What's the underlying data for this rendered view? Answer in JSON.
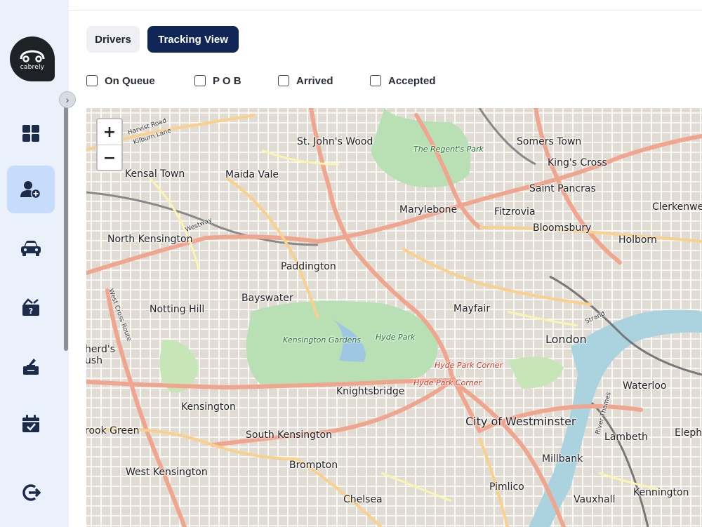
{
  "sidebar": {
    "logo_text": "cabrely",
    "items": [
      {
        "name": "dashboard",
        "active": false
      },
      {
        "name": "drivers",
        "active": true
      },
      {
        "name": "vehicles",
        "active": false
      },
      {
        "name": "lost-found",
        "active": false
      },
      {
        "name": "bookings",
        "active": false
      },
      {
        "name": "schedule",
        "active": false
      },
      {
        "name": "logout",
        "active": false
      }
    ]
  },
  "tabs": {
    "drivers": "Drivers",
    "tracking_view": "Tracking View"
  },
  "filters": [
    {
      "label": "On Queue",
      "checked": false
    },
    {
      "label": "P O B",
      "checked": false
    },
    {
      "label": "Arrived",
      "checked": false
    },
    {
      "label": "Accepted",
      "checked": false
    }
  ],
  "map": {
    "zoom_in": "+",
    "zoom_out": "−",
    "labels": {
      "st_johns_wood": "St. John's Wood",
      "somers_town": "Somers Town",
      "kings_cross": "King's Cross",
      "kensal_town": "Kensal Town",
      "maida_vale": "Maida Vale",
      "regents_park": "The Regent's Park",
      "saint_pancras": "Saint Pancras",
      "marylebone": "Marylebone",
      "fitzrovia": "Fitzrovia",
      "clerkenwell": "Clerkenwell",
      "bloomsbury": "Bloomsbury",
      "north_kensington": "North Kensington",
      "holborn": "Holborn",
      "paddington": "Paddington",
      "bayswater": "Bayswater",
      "notting_hill": "Notting Hill",
      "mayfair": "Mayfair",
      "kensington_gardens": "Kensington Gardens",
      "hyde_park": "Hyde Park",
      "london": "London",
      "strand": "Strand",
      "shepherds_bush": "herd's\nush",
      "hyde_park_corner": "Hyde Park Corner",
      "waterloo": "Waterloo",
      "knightsbridge": "Knightsbridge",
      "kensington": "Kensington",
      "city_of_westminster": "City of Westminster",
      "brook_green": "rook Green",
      "south_kensington": "South Kensington",
      "lambeth": "Lambeth",
      "elephant": "Eleph",
      "brompton": "Brompton",
      "millbank": "Millbank",
      "west_kensington": "West Kensington",
      "pimlico": "Pimlico",
      "kennington": "Kennington",
      "chelsea": "Chelsea",
      "vauxhall": "Vauxhall",
      "harvist_road": "Harvist Road",
      "kilburn_lane": "Kilburn Lane",
      "westway": "Westway",
      "west_cross_route": "West Cross Route",
      "river_thames": "River Thames"
    }
  },
  "colors": {
    "sidebar_bg": "#eaf1fb",
    "active_nav": "#c7dbfb",
    "tracking_tab": "#0f2656",
    "icon": "#1c2b4a"
  }
}
